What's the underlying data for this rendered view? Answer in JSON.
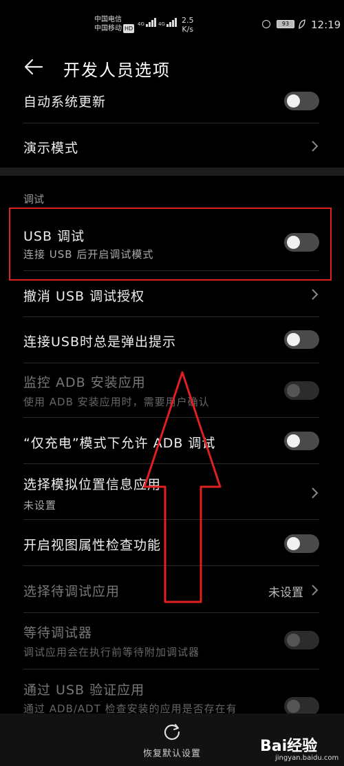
{
  "status_bar": {
    "carrier1": "中国电信",
    "carrier2": "中国移动",
    "hd": "HD",
    "net1": "4G",
    "net2": "4G",
    "speed_value": "2.5",
    "speed_unit": "K/s",
    "battery": "93",
    "time": "12:19"
  },
  "header": {
    "title": "开发人员选项"
  },
  "items": {
    "auto_update": {
      "title": "自动系统更新",
      "toggle": "off"
    },
    "demo_mode": {
      "title": "演示模式"
    },
    "section_debug": "调试",
    "usb_debug": {
      "title": "USB 调试",
      "subtitle": "连接 USB 后开启调试模式",
      "toggle": "off"
    },
    "revoke_usb": {
      "title": "撤消 USB 调试授权"
    },
    "usb_prompt": {
      "title": "连接USB时总是弹出提示",
      "toggle": "off"
    },
    "monitor_adb": {
      "title": "监控 ADB 安装应用",
      "subtitle": "使用 ADB 安装应用时，需要用户确认",
      "toggle": "off",
      "disabled": true
    },
    "charge_only_adb": {
      "title": "“仅充电”模式下允许 ADB 调试",
      "toggle": "off"
    },
    "mock_location": {
      "title": "选择模拟位置信息应用",
      "subtitle": "未设置"
    },
    "view_attr": {
      "title": "开启视图属性检查功能",
      "toggle": "off"
    },
    "debug_app": {
      "title": "选择待调试应用",
      "value": "未设置",
      "disabled": true
    },
    "wait_debugger": {
      "title": "等待调试器",
      "subtitle": "调试应用会在执行前等待附加调试器",
      "toggle": "off",
      "disabled": true
    },
    "verify_usb": {
      "title": "通过 USB 验证应用",
      "subtitle": "通过 ADB/ADT 检查安装的应用是否存在有",
      "toggle": "off",
      "disabled": true
    }
  },
  "bottom": {
    "reset_label": "恢复默认设置"
  },
  "watermark": {
    "brand": "Bai经验",
    "url": "jingyan.baidu.com"
  },
  "colors": {
    "highlight": "#e02020",
    "background": "#000000"
  }
}
